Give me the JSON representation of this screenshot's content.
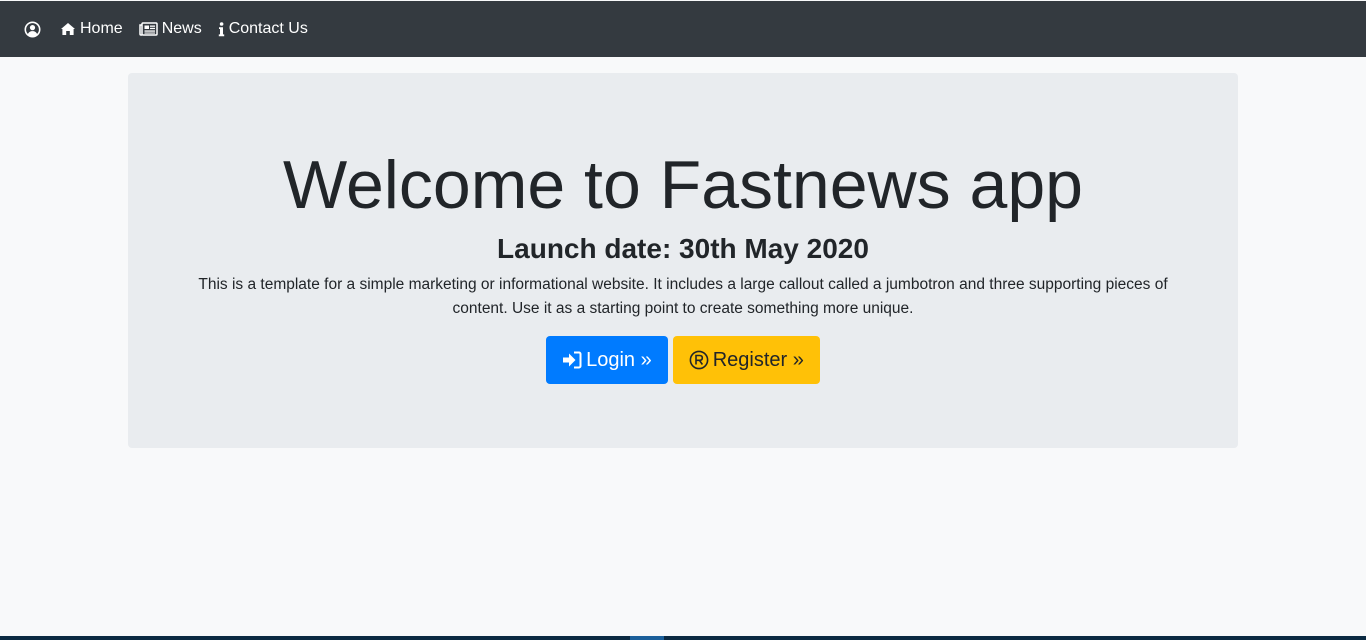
{
  "navbar": {
    "items": [
      {
        "label": "Home",
        "icon": "home-icon"
      },
      {
        "label": "News",
        "icon": "newspaper-icon"
      },
      {
        "label": "Contact Us",
        "icon": "info-icon"
      }
    ],
    "user_icon": "user-circle-icon"
  },
  "jumbotron": {
    "title": "Welcome to Fastnews app",
    "subtitle": "Launch date: 30th May 2020",
    "text": "This is a template for a simple marketing or informational website. It includes a large callout called a jumbotron and three supporting pieces of content. Use it as a starting point to create something more unique.",
    "login_label": "Login »",
    "register_label": "Register »"
  },
  "colors": {
    "navbar_bg": "#343a40",
    "jumbotron_bg": "#e9ecef",
    "login_bg": "#007bff",
    "register_bg": "#ffc107",
    "page_bg": "#f8f9fa"
  }
}
